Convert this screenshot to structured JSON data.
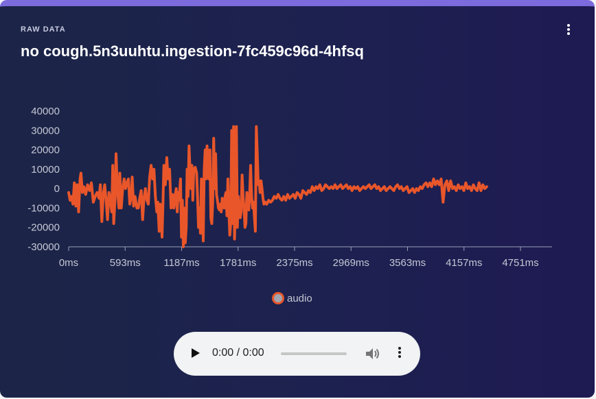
{
  "card": {
    "eyebrow": "RAW DATA",
    "title": "no cough.5n3uuhtu.ingestion-7fc459c96d-4hfsq"
  },
  "colors": {
    "series": "#e8562a",
    "axis": "#9aa0b8",
    "label": "#c4c8d4",
    "accent": "#7c6bdc"
  },
  "icons": {
    "card_menu": "more-vert-icon",
    "play": "play-icon",
    "volume": "volume-icon",
    "player_menu": "more-vert-icon"
  },
  "player": {
    "time": "0:00 / 0:00",
    "progress": 0
  },
  "legend": {
    "label": "audio"
  },
  "chart_data": {
    "type": "line",
    "title": "",
    "xlabel": "",
    "ylabel": "",
    "xlim": [
      0,
      5100
    ],
    "ylim": [
      -30000,
      40000
    ],
    "x_ticks": [
      "0ms",
      "593ms",
      "1187ms",
      "1781ms",
      "2375ms",
      "2969ms",
      "3563ms",
      "4157ms",
      "4751ms"
    ],
    "y_ticks": [
      "40000",
      "30000",
      "20000",
      "10000",
      "0",
      "-10000",
      "-20000",
      "-30000"
    ],
    "grid": false,
    "legend": "bottom",
    "series": [
      {
        "name": "audio",
        "points": [
          [
            0,
            -2000
          ],
          [
            15,
            -6000
          ],
          [
            30,
            -4000
          ],
          [
            45,
            -8000
          ],
          [
            60,
            3000
          ],
          [
            75,
            -9000
          ],
          [
            90,
            2000
          ],
          [
            105,
            -12000
          ],
          [
            120,
            5000
          ],
          [
            130,
            8000
          ],
          [
            145,
            -2000
          ],
          [
            160,
            1000
          ],
          [
            180,
            -3000
          ],
          [
            200,
            2000
          ],
          [
            220,
            -1000
          ],
          [
            240,
            3000
          ],
          [
            260,
            -7000
          ],
          [
            280,
            -4000
          ],
          [
            300,
            -2000
          ],
          [
            320,
            -5000
          ],
          [
            335,
            2000
          ],
          [
            350,
            -17000
          ],
          [
            365,
            -3000
          ],
          [
            380,
            2000
          ],
          [
            395,
            -6000
          ],
          [
            410,
            -16000
          ],
          [
            425,
            -2000
          ],
          [
            440,
            -6000
          ],
          [
            455,
            -12000
          ],
          [
            465,
            12000
          ],
          [
            475,
            -18000
          ],
          [
            490,
            -5000
          ],
          [
            500,
            18000
          ],
          [
            510,
            5000
          ],
          [
            520,
            -4000
          ],
          [
            530,
            -10000
          ],
          [
            540,
            8000
          ],
          [
            555,
            -10000
          ],
          [
            570,
            0
          ],
          [
            585,
            5000
          ],
          [
            600,
            0
          ],
          [
            615,
            3000
          ],
          [
            630,
            5000
          ],
          [
            645,
            -8000
          ],
          [
            660,
            -4000
          ],
          [
            670,
            6000
          ],
          [
            685,
            -9000
          ],
          [
            700,
            -4000
          ],
          [
            720,
            -10000
          ],
          [
            735,
            -10000
          ],
          [
            750,
            -5000
          ],
          [
            765,
            -1000
          ],
          [
            780,
            -16000
          ],
          [
            795,
            -5000
          ],
          [
            810,
            0
          ],
          [
            825,
            -6000
          ],
          [
            840,
            -8000
          ],
          [
            855,
            6000
          ],
          [
            870,
            12000
          ],
          [
            885,
            5000
          ],
          [
            900,
            10000
          ],
          [
            915,
            -4000
          ],
          [
            930,
            -12000
          ],
          [
            940,
            -7000
          ],
          [
            955,
            -22000
          ],
          [
            965,
            -8000
          ],
          [
            975,
            -12000
          ],
          [
            985,
            -25000
          ],
          [
            995,
            -8000
          ],
          [
            1005,
            12000
          ],
          [
            1020,
            2000
          ],
          [
            1035,
            16000
          ],
          [
            1050,
            5000
          ],
          [
            1065,
            10000
          ],
          [
            1080,
            -10000
          ],
          [
            1095,
            -3000
          ],
          [
            1110,
            -10000
          ],
          [
            1125,
            -3000
          ],
          [
            1135,
            0
          ],
          [
            1145,
            -12000
          ],
          [
            1155,
            -2000
          ],
          [
            1165,
            -6000
          ],
          [
            1180,
            5000
          ],
          [
            1190,
            -25000
          ],
          [
            1200,
            -6000
          ],
          [
            1210,
            -30000
          ],
          [
            1220,
            -10000
          ],
          [
            1230,
            -28000
          ],
          [
            1240,
            -20000
          ],
          [
            1250,
            10000
          ],
          [
            1260,
            -4000
          ],
          [
            1270,
            22000
          ],
          [
            1280,
            10000
          ],
          [
            1290,
            0
          ],
          [
            1300,
            12000
          ],
          [
            1310,
            -6000
          ],
          [
            1320,
            10000
          ],
          [
            1335,
            11000
          ],
          [
            1350,
            8000
          ],
          [
            1360,
            -4000
          ],
          [
            1370,
            -20000
          ],
          [
            1380,
            -10000
          ],
          [
            1390,
            -23000
          ],
          [
            1400,
            5000
          ],
          [
            1410,
            -6000
          ],
          [
            1420,
            -27000
          ],
          [
            1430,
            10000
          ],
          [
            1440,
            20000
          ],
          [
            1450,
            5000
          ],
          [
            1460,
            22000
          ],
          [
            1470,
            10000
          ],
          [
            1480,
            5000
          ],
          [
            1490,
            20000
          ],
          [
            1500,
            -15000
          ],
          [
            1510,
            -18000
          ],
          [
            1520,
            -7000
          ],
          [
            1530,
            26000
          ],
          [
            1540,
            0
          ],
          [
            1550,
            18000
          ],
          [
            1560,
            -3000
          ],
          [
            1570,
            -6000
          ],
          [
            1580,
            -10000
          ],
          [
            1590,
            -11000
          ],
          [
            1600,
            -8000
          ],
          [
            1610,
            -12000
          ],
          [
            1620,
            -5000
          ],
          [
            1630,
            -8000
          ],
          [
            1640,
            -10000
          ],
          [
            1650,
            -4000
          ],
          [
            1660,
            -2000
          ],
          [
            1670,
            -14000
          ],
          [
            1680,
            5000
          ],
          [
            1690,
            -12000
          ],
          [
            1700,
            -24000
          ],
          [
            1710,
            -18000
          ],
          [
            1720,
            30000
          ],
          [
            1730,
            -18000
          ],
          [
            1740,
            32000
          ],
          [
            1750,
            -26000
          ],
          [
            1760,
            -4000
          ],
          [
            1770,
            32000
          ],
          [
            1780,
            -20000
          ],
          [
            1790,
            -4000
          ],
          [
            1800,
            -12000
          ],
          [
            1810,
            -15000
          ],
          [
            1820,
            -12000
          ],
          [
            1830,
            7000
          ],
          [
            1840,
            -4000
          ],
          [
            1850,
            -10000
          ],
          [
            1860,
            -20000
          ],
          [
            1870,
            -18000
          ],
          [
            1880,
            -2000
          ],
          [
            1890,
            -5000
          ],
          [
            1900,
            -11000
          ],
          [
            1910,
            -2000
          ],
          [
            1920,
            12000
          ],
          [
            1930,
            -4000
          ],
          [
            1940,
            -10000
          ],
          [
            1950,
            -7000
          ],
          [
            1960,
            -15000
          ],
          [
            1970,
            -22000
          ],
          [
            1980,
            32000
          ],
          [
            1990,
            18000
          ],
          [
            2000,
            2000
          ],
          [
            2010,
            4000
          ],
          [
            2020,
            -2000
          ],
          [
            2030,
            4000
          ],
          [
            2040,
            0
          ],
          [
            2050,
            -5000
          ],
          [
            2060,
            -8000
          ],
          [
            2075,
            -7000
          ],
          [
            2090,
            -8000
          ],
          [
            2110,
            -6000
          ],
          [
            2130,
            -7000
          ],
          [
            2150,
            -6000
          ],
          [
            2170,
            -4000
          ],
          [
            2190,
            -5000
          ],
          [
            2210,
            -3000
          ],
          [
            2230,
            -5000
          ],
          [
            2250,
            -6000
          ],
          [
            2270,
            -4000
          ],
          [
            2290,
            -6000
          ],
          [
            2310,
            -3000
          ],
          [
            2330,
            -5000
          ],
          [
            2350,
            -4000
          ],
          [
            2370,
            -3000
          ],
          [
            2390,
            -5000
          ],
          [
            2410,
            -2000
          ],
          [
            2430,
            -3000
          ],
          [
            2450,
            -5000
          ],
          [
            2470,
            -1000
          ],
          [
            2490,
            -2000
          ],
          [
            2510,
            -3000
          ],
          [
            2530,
            -1000
          ],
          [
            2550,
            -2000
          ],
          [
            2570,
            1000
          ],
          [
            2590,
            -1000
          ],
          [
            2610,
            1000
          ],
          [
            2630,
            0
          ],
          [
            2650,
            2000
          ],
          [
            2670,
            -1000
          ],
          [
            2690,
            0
          ],
          [
            2710,
            2000
          ],
          [
            2730,
            1000
          ],
          [
            2750,
            0
          ],
          [
            2770,
            1000
          ],
          [
            2790,
            0
          ],
          [
            2810,
            2000
          ],
          [
            2830,
            0
          ],
          [
            2850,
            1000
          ],
          [
            2870,
            2000
          ],
          [
            2890,
            0
          ],
          [
            2910,
            1000
          ],
          [
            2930,
            2000
          ],
          [
            2950,
            0
          ],
          [
            2970,
            1000
          ],
          [
            2990,
            -1000
          ],
          [
            3010,
            1000
          ],
          [
            3030,
            0
          ],
          [
            3050,
            1000
          ],
          [
            3070,
            -1000
          ],
          [
            3090,
            0
          ],
          [
            3110,
            1000
          ],
          [
            3130,
            0
          ],
          [
            3150,
            1000
          ],
          [
            3170,
            2000
          ],
          [
            3190,
            0
          ],
          [
            3210,
            1000
          ],
          [
            3230,
            2000
          ],
          [
            3250,
            0
          ],
          [
            3270,
            1000
          ],
          [
            3290,
            -1000
          ],
          [
            3310,
            0
          ],
          [
            3330,
            1000
          ],
          [
            3350,
            -1000
          ],
          [
            3370,
            0
          ],
          [
            3390,
            1000
          ],
          [
            3410,
            0
          ],
          [
            3430,
            -1000
          ],
          [
            3450,
            1000
          ],
          [
            3470,
            2000
          ],
          [
            3490,
            0
          ],
          [
            3510,
            1000
          ],
          [
            3530,
            -1000
          ],
          [
            3550,
            0
          ],
          [
            3570,
            1000
          ],
          [
            3590,
            -2000
          ],
          [
            3610,
            -1000
          ],
          [
            3630,
            0
          ],
          [
            3650,
            -2000
          ],
          [
            3670,
            0
          ],
          [
            3690,
            -1000
          ],
          [
            3710,
            1000
          ],
          [
            3730,
            0
          ],
          [
            3750,
            2000
          ],
          [
            3770,
            3000
          ],
          [
            3790,
            1000
          ],
          [
            3810,
            3000
          ],
          [
            3830,
            1000
          ],
          [
            3850,
            5000
          ],
          [
            3870,
            2000
          ],
          [
            3890,
            4000
          ],
          [
            3910,
            2000
          ],
          [
            3930,
            5000
          ],
          [
            3950,
            -7000
          ],
          [
            3970,
            2000
          ],
          [
            3990,
            4000
          ],
          [
            4010,
            -1000
          ],
          [
            4030,
            4000
          ],
          [
            4050,
            0
          ],
          [
            4070,
            1000
          ],
          [
            4090,
            -1000
          ],
          [
            4110,
            2000
          ],
          [
            4130,
            0
          ],
          [
            4150,
            1000
          ],
          [
            4170,
            -1000
          ],
          [
            4190,
            3000
          ],
          [
            4210,
            0
          ],
          [
            4230,
            1000
          ],
          [
            4250,
            -1000
          ],
          [
            4270,
            2000
          ],
          [
            4290,
            0
          ],
          [
            4310,
            -1000
          ],
          [
            4330,
            3000
          ],
          [
            4350,
            -1000
          ],
          [
            4370,
            2000
          ],
          [
            4390,
            0
          ],
          [
            4410,
            1000
          ]
        ]
      }
    ]
  }
}
